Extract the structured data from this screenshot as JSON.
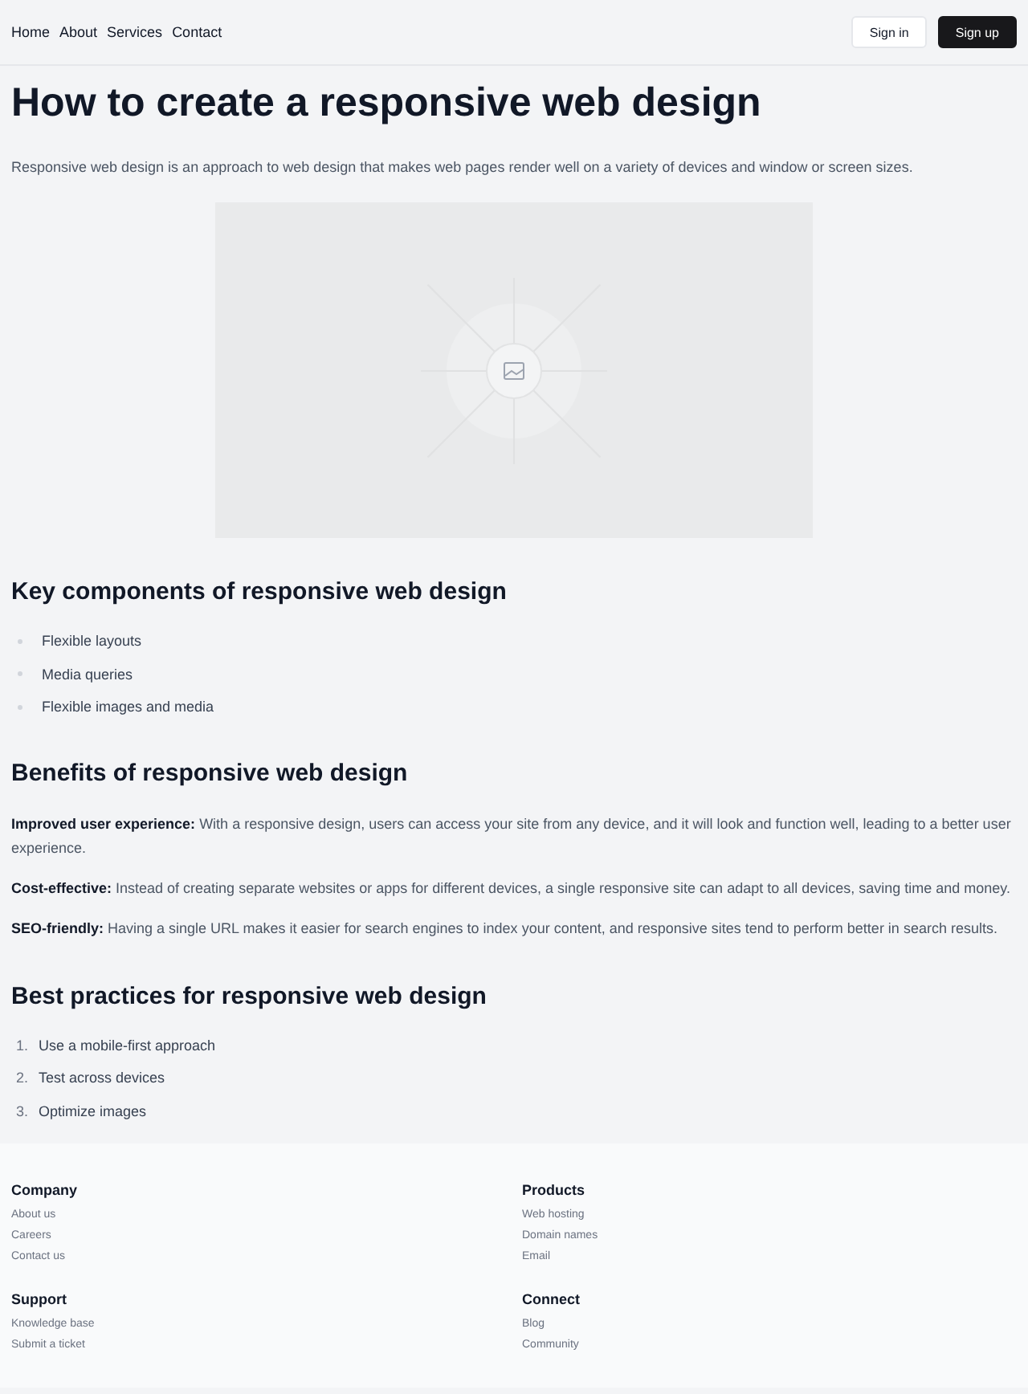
{
  "nav": {
    "links": [
      "Home",
      "About",
      "Services",
      "Contact"
    ],
    "buttons": [
      {
        "label": "Sign in",
        "kind": "secondary"
      },
      {
        "label": "Sign up",
        "kind": "primary"
      }
    ]
  },
  "title": "How to create a responsive web design",
  "intro": "Responsive web design is an approach to web design that makes web pages render well on a variety of devices and window or screen sizes.",
  "image": {
    "kind": "placeholder"
  },
  "components": {
    "heading": "Key components of responsive web design",
    "items": [
      "Flexible layouts",
      "Media queries",
      "Flexible images and media"
    ]
  },
  "benefits": {
    "heading": "Benefits of responsive web design",
    "paragraphs": [
      "**Improved user experience:** With a responsive design, users can access your site from any device, and it will look and function well, leading to a better user experience.",
      "**Cost-effective:** Instead of creating separate websites or apps for different devices, a single responsive site can adapt to all devices, saving time and money.",
      "**SEO-friendly:** Having a single URL makes it easier for search engines to index your content, and responsive sites tend to perform better in search results."
    ]
  },
  "practices": {
    "heading": "Best practices for responsive web design",
    "items": [
      {
        "number": "1.",
        "text": "Use a mobile-first approach"
      },
      {
        "number": "2.",
        "text": "Test across devices"
      },
      {
        "number": "3.",
        "text": "Optimize images"
      }
    ]
  },
  "footer": {
    "columns": [
      {
        "heading": "Company",
        "links": [
          "About us",
          "Careers",
          "Contact us"
        ]
      },
      {
        "heading": "Products",
        "links": [
          "Web hosting",
          "Domain names",
          "Email"
        ]
      },
      {
        "heading": "Support",
        "links": [
          "Knowledge base",
          "Submit a ticket"
        ]
      },
      {
        "heading": "Connect",
        "links": [
          "Blog",
          "Community"
        ]
      }
    ]
  }
}
